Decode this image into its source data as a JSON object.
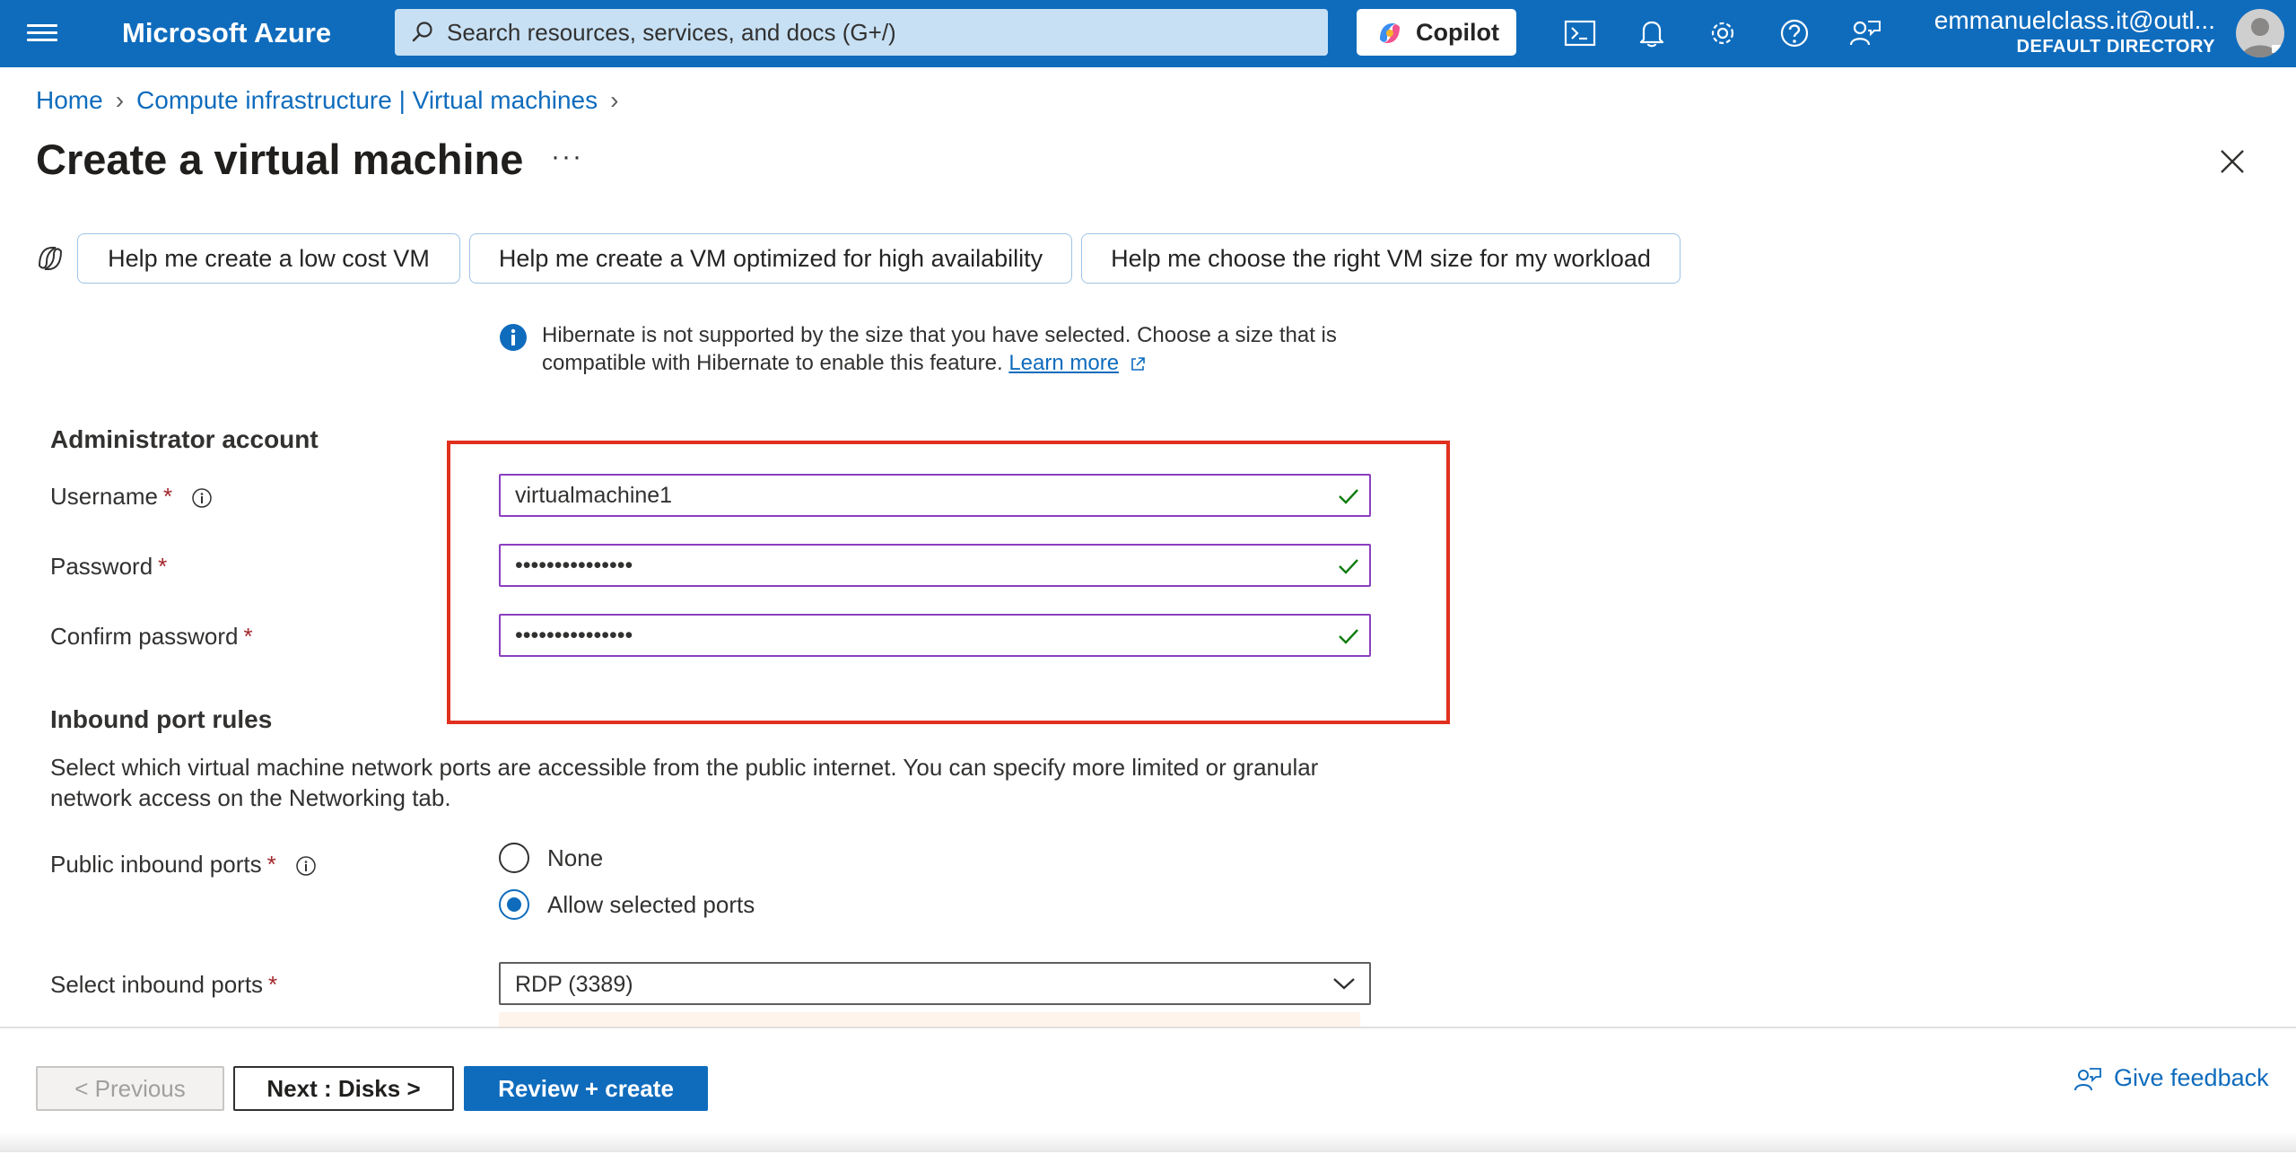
{
  "topbar": {
    "brand": "Microsoft Azure",
    "search_placeholder": "Search resources, services, and docs (G+/)",
    "copilot_label": "Copilot",
    "account_email": "emmanuelclass.it@outl...",
    "account_directory": "DEFAULT DIRECTORY"
  },
  "breadcrumb": {
    "home": "Home",
    "parent": "Compute infrastructure | Virtual machines"
  },
  "page": {
    "title": "Create a virtual machine",
    "more": "···"
  },
  "suggestions": [
    {
      "label": "Help me create a low cost VM"
    },
    {
      "label": "Help me create a VM optimized for high availability"
    },
    {
      "label": "Help me choose the right VM size for my workload"
    }
  ],
  "info_banner": {
    "text": "Hibernate is not supported by the size that you have selected. Choose a size that is compatible with Hibernate to enable this feature.",
    "link": "Learn more"
  },
  "admin": {
    "heading": "Administrator account",
    "username_label": "Username",
    "username_value": "virtualmachine1",
    "password_label": "Password",
    "password_value": "•••••••••••••••",
    "confirm_label": "Confirm password",
    "confirm_value": "•••••••••••••••",
    "required_mark": "*"
  },
  "inbound": {
    "heading": "Inbound port rules",
    "description": "Select which virtual machine network ports are accessible from the public internet. You can specify more limited or granular network access on the Networking tab.",
    "public_ports_label": "Public inbound ports",
    "option_none": "None",
    "option_allow": "Allow selected ports",
    "selected_option": "Allow selected ports",
    "select_ports_label": "Select inbound ports",
    "select_ports_value": "RDP (3389)"
  },
  "footer": {
    "previous": "< Previous",
    "next": "Next : Disks >",
    "review": "Review + create",
    "feedback": "Give feedback"
  },
  "colors": {
    "accent": "#0f6cbd",
    "highlight": "#e0301e",
    "field_border": "#8a3fbf",
    "valid_check": "#107c10",
    "required": "#a4262c"
  },
  "icons": [
    "hamburger-icon",
    "search-icon",
    "copilot-icon",
    "cloud-shell-icon",
    "bell-icon",
    "gear-icon",
    "help-icon",
    "feedback-icon",
    "avatar-icon",
    "close-icon",
    "info-icon",
    "external-link-icon",
    "check-icon",
    "chevron-down-icon"
  ]
}
